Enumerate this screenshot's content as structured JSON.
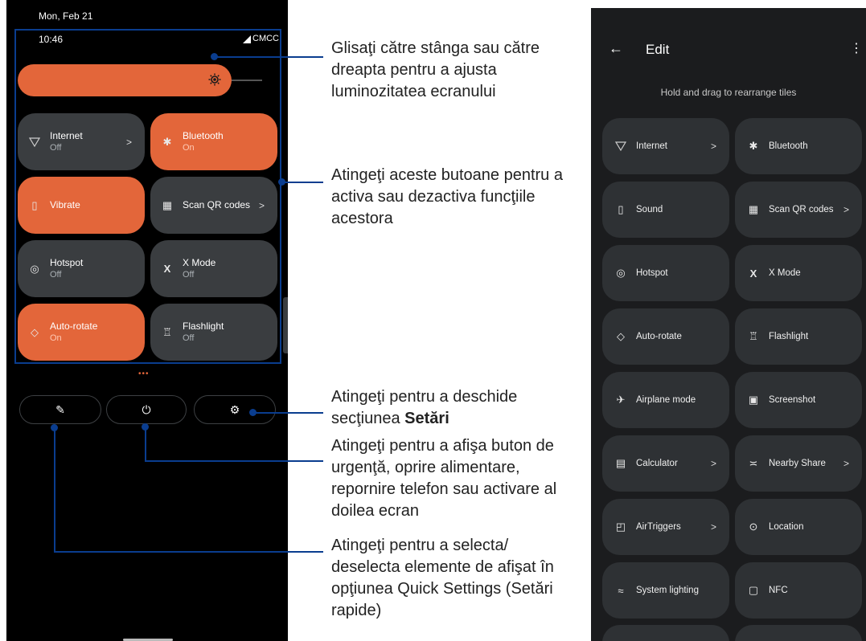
{
  "left_phone": {
    "date": "Mon, Feb 21",
    "time": "10:46",
    "carrier": "CMCC",
    "signal_icon": "signal-icon",
    "brightness_icon": "brightness-icon",
    "tiles": [
      {
        "label": "Internet",
        "status": "Off",
        "icon": "wifi-icon",
        "chevron": ">",
        "on": false
      },
      {
        "label": "Bluetooth",
        "status": "On",
        "icon": "bluetooth-icon",
        "chevron": "",
        "on": true
      },
      {
        "label": "Vibrate",
        "status": "",
        "icon": "vibrate-icon",
        "chevron": "",
        "on": true
      },
      {
        "label": "Scan QR codes",
        "status": "",
        "icon": "qr-icon",
        "chevron": ">",
        "on": false
      },
      {
        "label": "Hotspot",
        "status": "Off",
        "icon": "hotspot-icon",
        "chevron": "",
        "on": false
      },
      {
        "label": "X Mode",
        "status": "Off",
        "icon": "xmode-icon",
        "chevron": "",
        "on": false
      },
      {
        "label": "Auto-rotate",
        "status": "On",
        "icon": "rotate-icon",
        "chevron": "",
        "on": true
      },
      {
        "label": "Flashlight",
        "status": "Off",
        "icon": "flashlight-icon",
        "chevron": "",
        "on": false
      }
    ],
    "page_dots": "•••",
    "bottom_buttons": [
      "edit-icon",
      "power-icon",
      "settings-icon"
    ]
  },
  "callouts": {
    "brightness": "Glisaţi către stânga sau către dreapta pentru a ajusta luminozitatea ecranului",
    "tiles": "Atingeţi aceste butoane pentru a activa sau dezactiva funcţiile acestora",
    "settings_prefix": "Atingeţi pentru a deschide secţiunea ",
    "settings_bold": "Setări",
    "power": "Atingeţi pentru a afişa buton de urgenţă, oprire alimentare, repornire telefon sau activare al doilea ecran",
    "edit": "Atingeţi pentru a selecta/ deselecta elemente de afişat în opţiunea Quick Settings (Setări rapide)"
  },
  "right_phone": {
    "back_icon": "back-arrow-icon",
    "title": "Edit",
    "menu_icon": "more-vert-icon",
    "hint": "Hold and drag to rearrange tiles",
    "tiles": [
      {
        "label": "Internet",
        "icon": "wifi-icon",
        "chevron": ">"
      },
      {
        "label": "Bluetooth",
        "icon": "bluetooth-icon",
        "chevron": ""
      },
      {
        "label": "Sound",
        "icon": "vibrate-icon",
        "chevron": ""
      },
      {
        "label": "Scan QR codes",
        "icon": "qr-icon",
        "chevron": ">"
      },
      {
        "label": "Hotspot",
        "icon": "hotspot-icon",
        "chevron": ""
      },
      {
        "label": "X Mode",
        "icon": "xmode-icon",
        "chevron": ""
      },
      {
        "label": "Auto-rotate",
        "icon": "rotate-icon",
        "chevron": ""
      },
      {
        "label": "Flashlight",
        "icon": "flashlight-icon",
        "chevron": ""
      },
      {
        "label": "Airplane mode",
        "icon": "airplane-icon",
        "chevron": ""
      },
      {
        "label": "Screenshot",
        "icon": "screenshot-icon",
        "chevron": ""
      },
      {
        "label": "Calculator",
        "icon": "calculator-icon",
        "chevron": ">"
      },
      {
        "label": "Nearby Share",
        "icon": "nearby-share-icon",
        "chevron": ">"
      },
      {
        "label": "AirTriggers",
        "icon": "airtriggers-icon",
        "chevron": ">"
      },
      {
        "label": "Location",
        "icon": "location-icon",
        "chevron": ""
      },
      {
        "label": "System lighting",
        "icon": "system-lighting-icon",
        "chevron": ""
      },
      {
        "label": "NFC",
        "icon": "nfc-icon",
        "chevron": ""
      }
    ]
  },
  "colors": {
    "accent_orange": "#e3663a",
    "tile_off": "#3a3d40",
    "callout_blue": "#0a3d8f"
  }
}
